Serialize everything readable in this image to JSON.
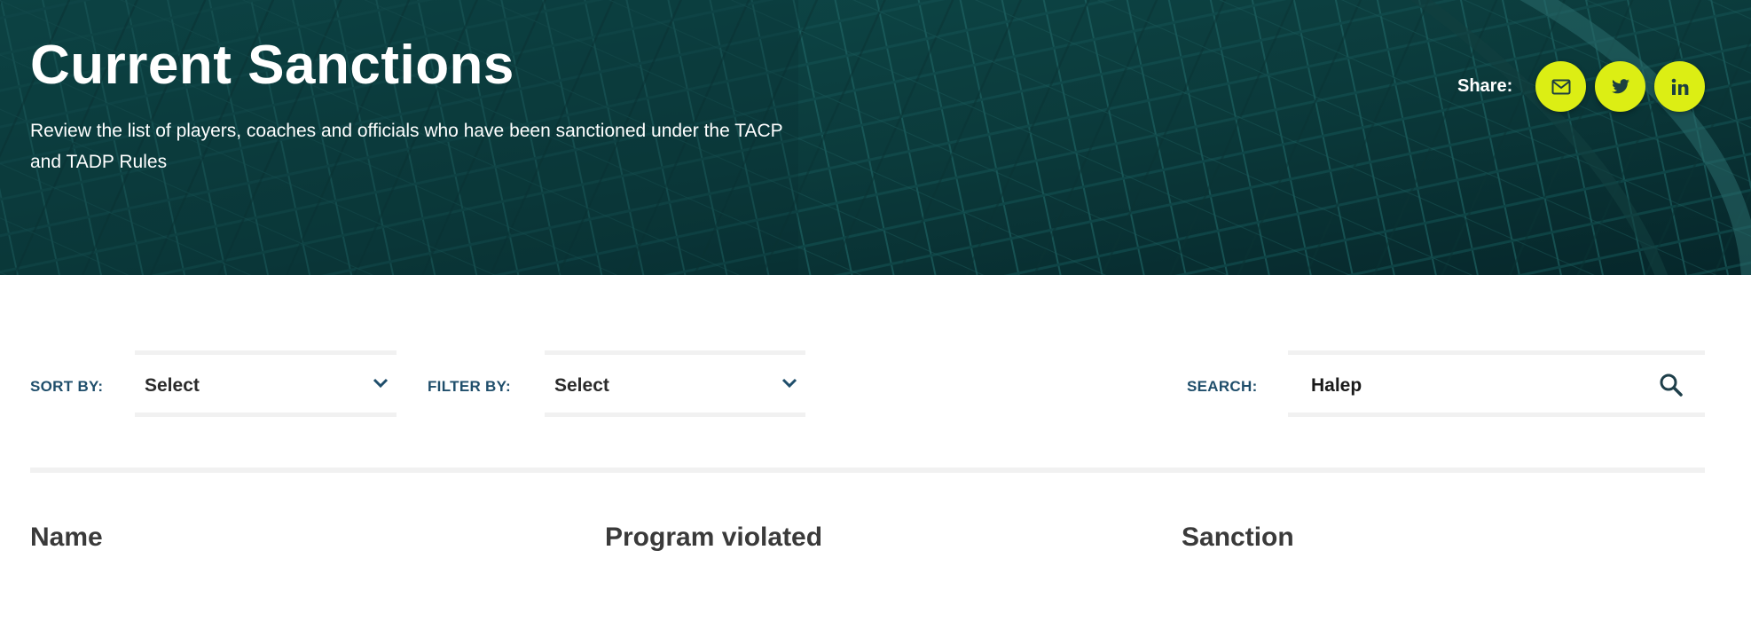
{
  "hero": {
    "title": "Current Sanctions",
    "description": "Review the list of players, coaches and officials who have been sanctioned under the TACP and TADP Rules",
    "share_label": "Share:",
    "share_buttons": [
      {
        "icon": "mail-icon"
      },
      {
        "icon": "twitter-icon"
      },
      {
        "icon": "linkedin-icon"
      }
    ]
  },
  "controls": {
    "sort_label": "SORT BY:",
    "sort_value": "Select",
    "filter_label": "FILTER BY:",
    "filter_value": "Select",
    "search_label": "SEARCH:",
    "search_value": "Halep"
  },
  "table": {
    "columns": [
      "Name",
      "Program violated",
      "Sanction"
    ]
  },
  "colors": {
    "hero_bg": "#0c3d3d",
    "accent": "#dcee14",
    "label": "#1f4e6b"
  }
}
